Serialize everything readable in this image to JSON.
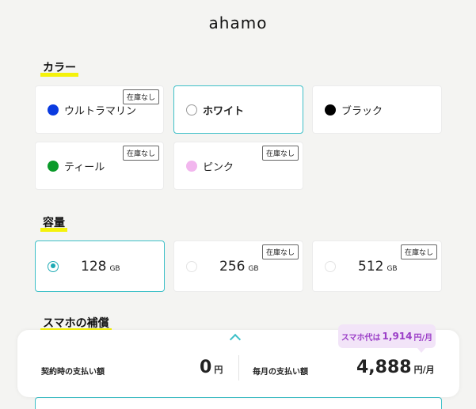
{
  "header": {
    "logo": "ahamo"
  },
  "color_section": {
    "title": "カラー",
    "options": [
      {
        "label": "ウルトラマリン",
        "swatch": "#0a3be0",
        "badge": "在庫なし",
        "selected": false
      },
      {
        "label": "ホワイト",
        "swatch": "#ffffff",
        "badge": "",
        "selected": true
      },
      {
        "label": "ブラック",
        "swatch": "#000000",
        "badge": "",
        "selected": false
      },
      {
        "label": "ティール",
        "swatch": "#0a9a2a",
        "badge": "在庫なし",
        "selected": false
      },
      {
        "label": "ピンク",
        "swatch": "#f2b6ee",
        "badge": "在庫なし",
        "selected": false
      }
    ]
  },
  "capacity_section": {
    "title": "容量",
    "unit": "GB",
    "options": [
      {
        "value": "128",
        "badge": "",
        "selected": true
      },
      {
        "value": "256",
        "badge": "在庫なし",
        "selected": false
      },
      {
        "value": "512",
        "badge": "在庫なし",
        "selected": false
      }
    ]
  },
  "warranty_section": {
    "title": "スマホの補償"
  },
  "price_bar": {
    "initial_label": "契約時の支払い額",
    "initial_value": "0",
    "initial_unit": "円",
    "monthly_label": "毎月の支払い額",
    "monthly_value": "4,888",
    "monthly_unit": "円/月",
    "bubble_prefix": "スマホ代は",
    "bubble_value": "1,914",
    "bubble_unit": "円/月"
  },
  "colors": {
    "accent": "#3ec0c8",
    "highlight": "#f4f20a",
    "bubble": "#9b3ec7"
  }
}
